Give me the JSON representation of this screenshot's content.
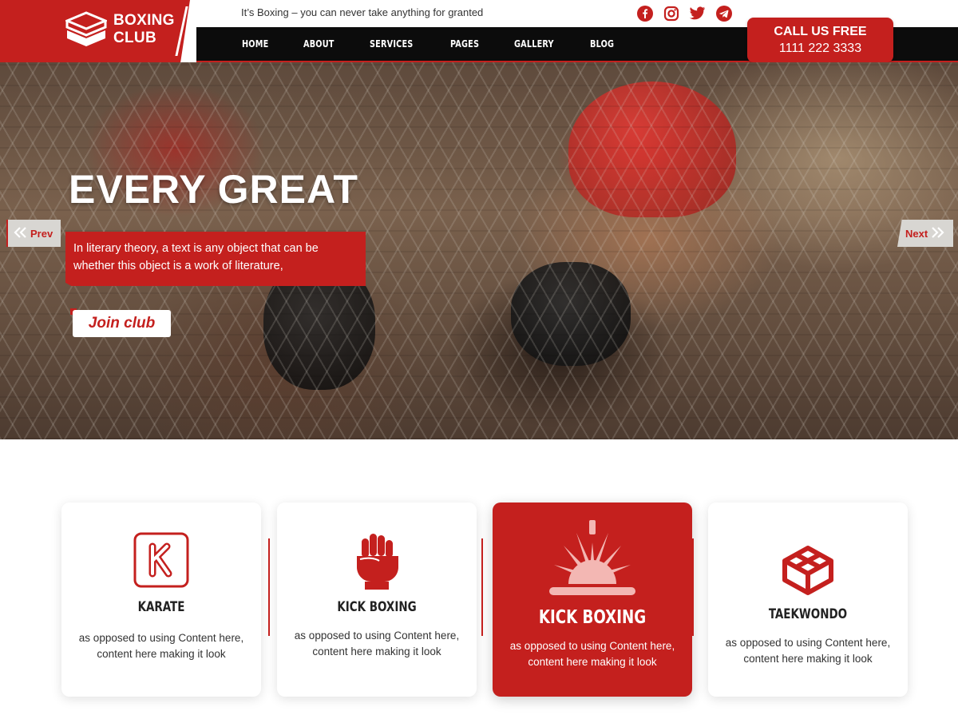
{
  "header": {
    "logo_line1": "BOXING",
    "logo_line2": "CLUB",
    "tagline": "It’s Boxing – you can never take anything for granted",
    "socials": [
      "facebook-icon",
      "instagram-icon",
      "twitter-icon",
      "telegram-icon"
    ],
    "nav": [
      "HOME",
      "ABOUT",
      "SERVICES",
      "PAGES",
      "GALLERY",
      "BLOG"
    ],
    "call_title": "CALL US FREE",
    "call_number": "1111 222 3333"
  },
  "hero": {
    "title": "EVERY GREAT",
    "text": "In literary theory, a text is any object that can be whether this object is a work of literature,",
    "button": "Join club",
    "prev": "Prev",
    "next": "Next"
  },
  "services": [
    {
      "title": "KARATE",
      "text": "as opposed to using Content here, content here making it look",
      "icon": "karate-k-icon"
    },
    {
      "title": "KICK BOXING",
      "text": "as opposed to using Content here, content here making it look",
      "icon": "fist-icon"
    },
    {
      "title": "KICK BOXING",
      "text": "as opposed to using Content here, content here making it look",
      "icon": "sunburst-icon"
    },
    {
      "title": "TAEKWONDO",
      "text": "as opposed to using Content here, content here making it look",
      "icon": "cube-icon"
    }
  ],
  "colors": {
    "brand": "#c4201e",
    "nav_bg": "#0c0c0c"
  }
}
